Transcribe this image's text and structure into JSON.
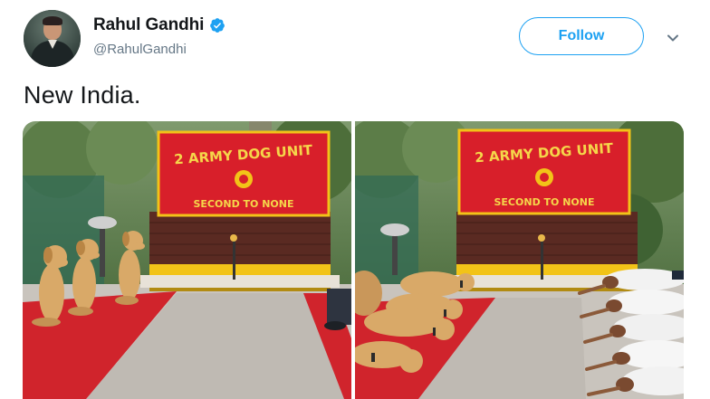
{
  "author": {
    "display_name": "Rahul Gandhi",
    "handle": "@RahulGandhi",
    "verified": true,
    "avatar_icon": "profile-photo"
  },
  "actions": {
    "follow_label": "Follow",
    "more_icon": "chevron-down-icon"
  },
  "tweet": {
    "text": "New India."
  },
  "media": {
    "photos": [
      {
        "sign_line1": "2 ARMY DOG UNIT",
        "sign_line2": "SECOND TO NONE",
        "scene": "dogs-sitting"
      },
      {
        "sign_line1": "2 ARMY DOG UNIT",
        "sign_line2": "SECOND TO NONE",
        "scene": "dogs-and-soldiers-yoga"
      }
    ]
  },
  "colors": {
    "accent": "#1da1f2",
    "sign_red": "#d81f2a",
    "carpet_red": "#d0242c",
    "wall_yellow": "#f2c318",
    "wall_brick": "#5a2a22"
  }
}
